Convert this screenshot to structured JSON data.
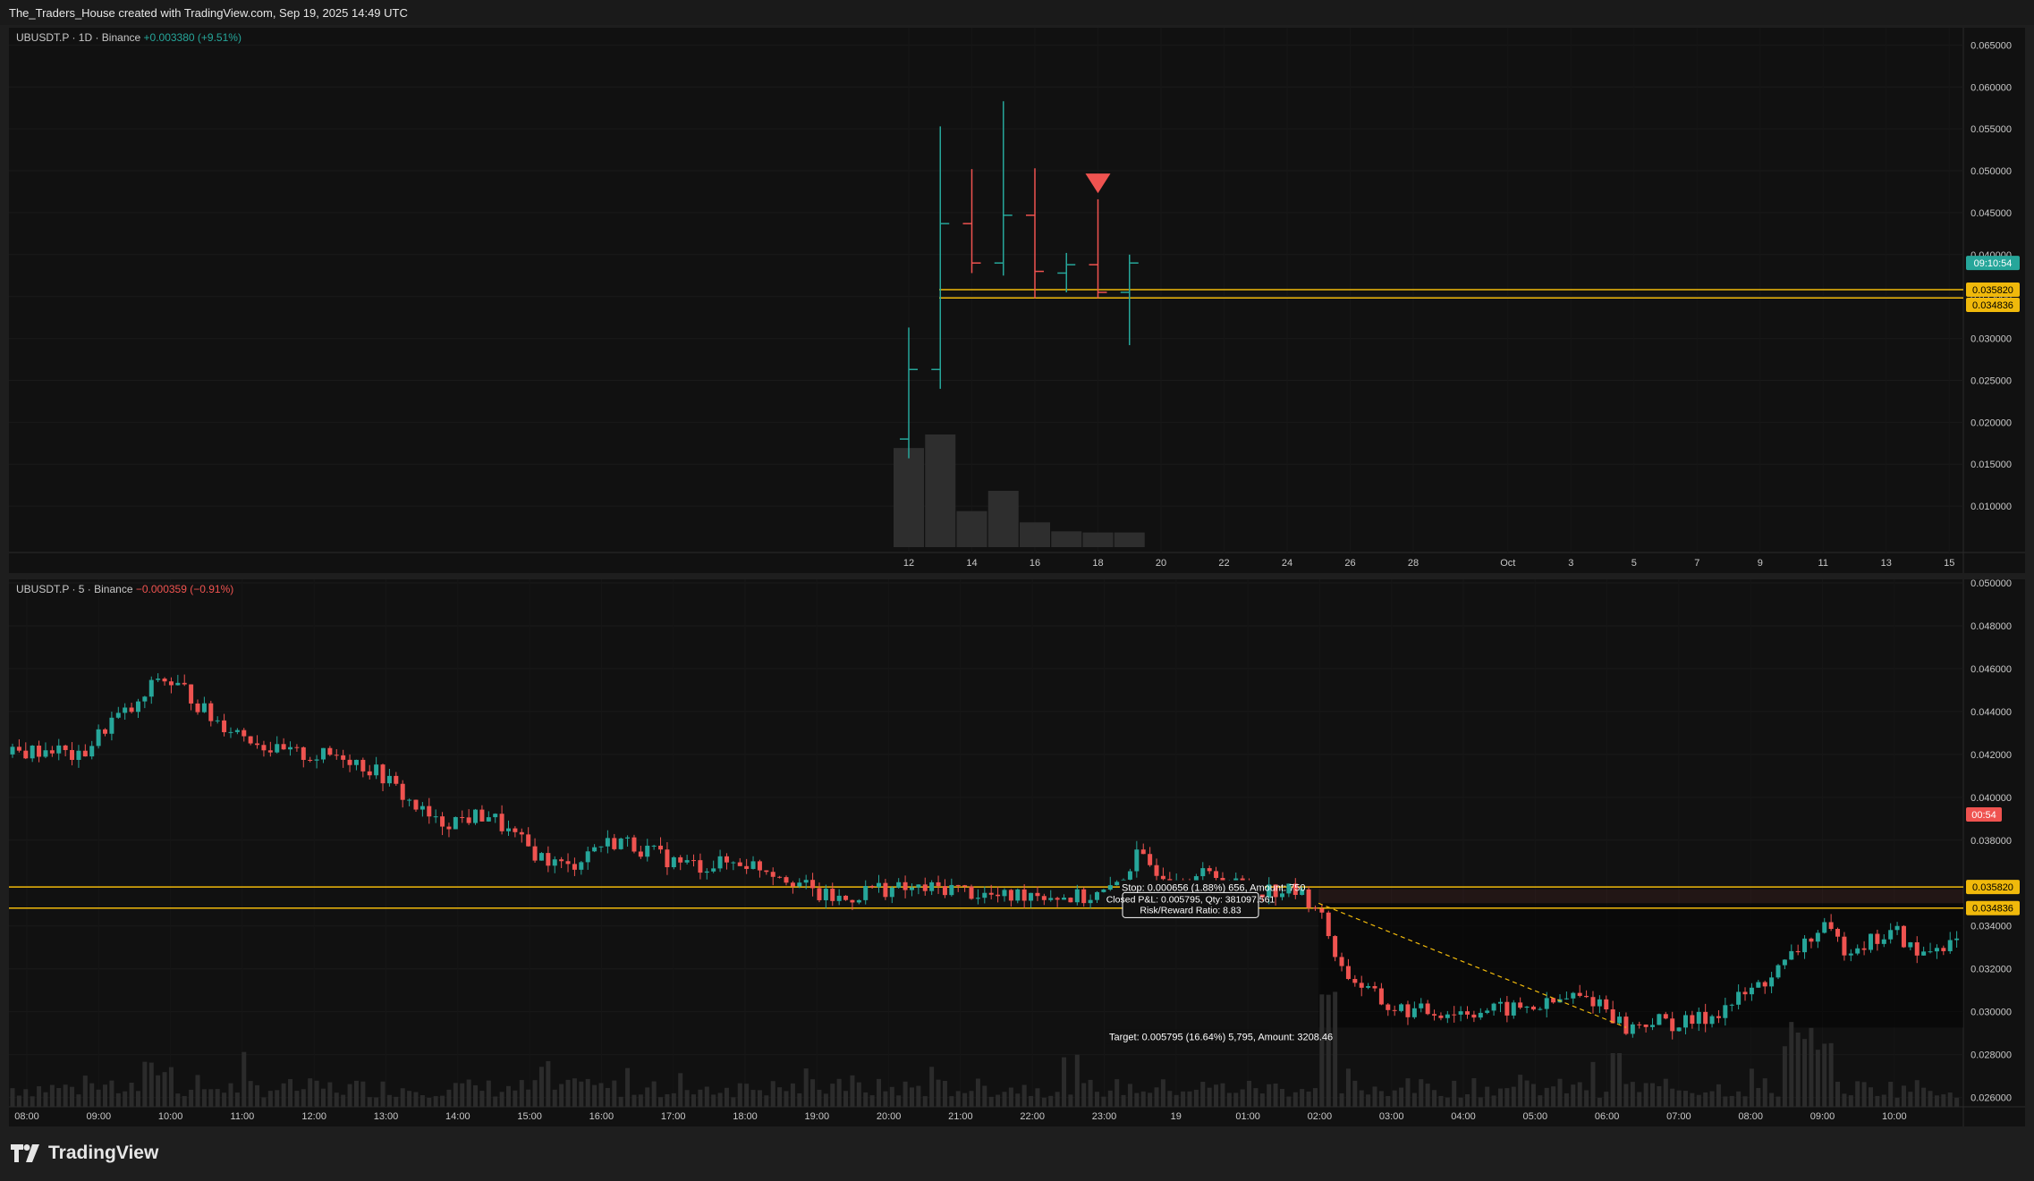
{
  "header": {
    "text": "The_Traders_House created with TradingView.com, Sep 19, 2025 14:49 UTC"
  },
  "top_panel": {
    "symbol": "UBUSDT.P · 1D · Binance",
    "change": "+0.003380 (+9.51%)"
  },
  "bottom_panel": {
    "symbol": "UBUSDT.P · 5 · Binance",
    "change": "−0.000359 (−0.91%)"
  },
  "footer": {
    "brand": "TradingView"
  },
  "colors": {
    "up": "#26a69a",
    "down": "#ef5350",
    "level": "#f0b90b",
    "background": "#111111"
  },
  "chart_data": [
    {
      "type": "candlestick",
      "timeframe": "1D",
      "price_scale": {
        "min": 0.005,
        "max": 0.066,
        "ticks": [
          "0.065000",
          "0.060000",
          "0.055000",
          "0.050000",
          "0.045000",
          "0.040000",
          "0.035000",
          "0.030000",
          "0.025000",
          "0.020000",
          "0.015000",
          "0.010000"
        ]
      },
      "x_ticks": [
        "12",
        "14",
        "16",
        "18",
        "20",
        "22",
        "24",
        "26",
        "28",
        "Oct",
        "3",
        "5",
        "7",
        "9",
        "11",
        "13",
        "15"
      ],
      "candles": [
        {
          "day": 12,
          "o": 0.018,
          "h": 0.0313,
          "l": 0.0157,
          "c": 0.0263
        },
        {
          "day": 13,
          "o": 0.0263,
          "h": 0.0553,
          "l": 0.024,
          "c": 0.0437
        },
        {
          "day": 14,
          "o": 0.0437,
          "h": 0.0502,
          "l": 0.0378,
          "c": 0.039
        },
        {
          "day": 15,
          "o": 0.039,
          "h": 0.0583,
          "l": 0.0375,
          "c": 0.0447
        },
        {
          "day": 16,
          "o": 0.0447,
          "h": 0.0503,
          "l": 0.0348,
          "c": 0.038
        },
        {
          "day": 17,
          "o": 0.0378,
          "h": 0.0402,
          "l": 0.0355,
          "c": 0.0388
        },
        {
          "day": 18,
          "o": 0.0388,
          "h": 0.0466,
          "l": 0.0348,
          "c": 0.0355
        },
        {
          "day": 19,
          "o": 0.0355,
          "h": 0.04,
          "l": 0.0292,
          "c": 0.039
        }
      ],
      "volume": [
        {
          "day": 12,
          "v": 0.88
        },
        {
          "day": 13,
          "v": 1.0
        },
        {
          "day": 14,
          "v": 0.32
        },
        {
          "day": 15,
          "v": 0.5
        },
        {
          "day": 16,
          "v": 0.22
        },
        {
          "day": 17,
          "v": 0.14
        },
        {
          "day": 18,
          "v": 0.13
        },
        {
          "day": 19,
          "v": 0.13
        }
      ],
      "signal_marker": {
        "day": 18,
        "type": "sell-arrow",
        "price": 0.0485
      },
      "levels": [
        0.03582,
        0.034836
      ],
      "price_labels": [
        {
          "text": "09:10:54",
          "price": 0.039,
          "color": "#26a69a"
        },
        {
          "text": "0.035820",
          "price": 0.03582,
          "color": "#f0b90b"
        },
        {
          "text": "0.034836",
          "price": 0.034836,
          "color": "#f0b90b"
        }
      ]
    },
    {
      "type": "candlestick",
      "timeframe": "5",
      "price_scale": {
        "min": 0.0254,
        "max": 0.05,
        "ticks": [
          "0.050000",
          "0.048000",
          "0.046000",
          "0.044000",
          "0.042000",
          "0.040000",
          "0.038000",
          "0.034000",
          "0.032000",
          "0.030000",
          "0.028000",
          "0.026000"
        ]
      },
      "x_ticks": [
        "08:00",
        "09:00",
        "10:00",
        "11:00",
        "12:00",
        "13:00",
        "14:00",
        "15:00",
        "16:00",
        "17:00",
        "18:00",
        "19:00",
        "20:00",
        "21:00",
        "22:00",
        "23:00",
        "19",
        "01:00",
        "02:00",
        "03:00",
        "04:00",
        "05:00",
        "06:00",
        "07:00",
        "08:00",
        "09:00",
        "10:00"
      ],
      "price_path": [
        [
          0,
          0.042
        ],
        [
          6,
          0.0423
        ],
        [
          10,
          0.0418
        ],
        [
          15,
          0.0436
        ],
        [
          19,
          0.0442
        ],
        [
          22,
          0.0456
        ],
        [
          26,
          0.045
        ],
        [
          30,
          0.0437
        ],
        [
          36,
          0.0428
        ],
        [
          40,
          0.0421
        ],
        [
          46,
          0.0419
        ],
        [
          50,
          0.042
        ],
        [
          56,
          0.041
        ],
        [
          60,
          0.0398
        ],
        [
          64,
          0.0388
        ],
        [
          68,
          0.039
        ],
        [
          72,
          0.0392
        ],
        [
          76,
          0.0381
        ],
        [
          80,
          0.0372
        ],
        [
          84,
          0.0367
        ],
        [
          88,
          0.0377
        ],
        [
          92,
          0.038
        ],
        [
          96,
          0.0375
        ],
        [
          100,
          0.037
        ],
        [
          104,
          0.0368
        ],
        [
          110,
          0.037
        ],
        [
          114,
          0.0367
        ],
        [
          118,
          0.0362
        ],
        [
          122,
          0.0354
        ],
        [
          126,
          0.0352
        ],
        [
          130,
          0.0358
        ],
        [
          134,
          0.0357
        ],
        [
          138,
          0.0357
        ],
        [
          142,
          0.0358
        ],
        [
          146,
          0.0355
        ],
        [
          150,
          0.0353
        ],
        [
          154,
          0.0356
        ],
        [
          158,
          0.0354
        ],
        [
          162,
          0.0353
        ],
        [
          166,
          0.0356
        ],
        [
          170,
          0.0372
        ],
        [
          174,
          0.0365
        ],
        [
          178,
          0.0363
        ],
        [
          182,
          0.0364
        ],
        [
          186,
          0.0358
        ],
        [
          190,
          0.0357
        ],
        [
          194,
          0.0356
        ],
        [
          197,
          0.035
        ],
        [
          199,
          0.0336
        ],
        [
          201,
          0.032
        ],
        [
          204,
          0.0312
        ],
        [
          208,
          0.0302
        ],
        [
          212,
          0.03
        ],
        [
          218,
          0.03
        ],
        [
          226,
          0.0301
        ],
        [
          232,
          0.0303
        ],
        [
          236,
          0.0307
        ],
        [
          240,
          0.0305
        ],
        [
          244,
          0.0292
        ],
        [
          248,
          0.0296
        ],
        [
          252,
          0.0294
        ],
        [
          256,
          0.0297
        ],
        [
          260,
          0.0304
        ],
        [
          264,
          0.0312
        ],
        [
          268,
          0.0322
        ],
        [
          271,
          0.0333
        ],
        [
          274,
          0.0338
        ],
        [
          277,
          0.033
        ],
        [
          281,
          0.0333
        ],
        [
          285,
          0.0337
        ],
        [
          288,
          0.0326
        ],
        [
          292,
          0.0332
        ]
      ],
      "levels": [
        0.03582,
        0.034836
      ],
      "price_labels": [
        {
          "text": "00:54",
          "price": 0.0392,
          "color": "#ef5350"
        },
        {
          "text": "0.035820",
          "price": 0.03582,
          "color": "#f0b90b"
        },
        {
          "text": "0.034836",
          "price": 0.034836,
          "color": "#f0b90b"
        }
      ],
      "position_tool": {
        "entry": 0.03506,
        "stop": 0.035716,
        "target": 0.029265,
        "stop_label": "Stop: 0.000656 (1.88%) 656, Amount: 750",
        "result_label_1": "Closed P&L: 0.005795, Qty: 381097.561",
        "result_label_2": "Risk/Reward Ratio: 8.83",
        "target_label": "Target: 0.005795 (16.64%) 5,795, Amount: 3208.46"
      }
    }
  ]
}
